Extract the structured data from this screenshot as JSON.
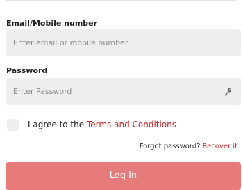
{
  "form": {
    "email": {
      "label": "Email/Mobile number",
      "placeholder": "Enter email or mobile number",
      "value": ""
    },
    "password": {
      "label": "Password",
      "placeholder": "Enter Password",
      "value": "",
      "icon": "key-icon"
    },
    "terms": {
      "checked": false,
      "text": "I agree to the ",
      "link_label": "Terms and Conditions"
    },
    "forgot": {
      "text": "Forgot password? ",
      "link_label": "Recover it"
    },
    "login_label": "Log In"
  },
  "colors": {
    "accent": "#c62828",
    "button": "#e77a7a",
    "field_background": "#eeeeee"
  }
}
